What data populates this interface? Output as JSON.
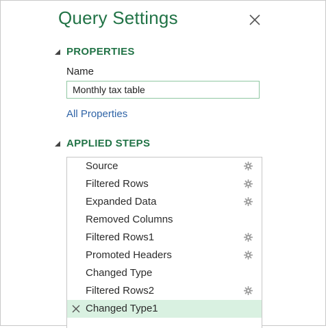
{
  "panel": {
    "title": "Query Settings",
    "close_icon": "close-icon"
  },
  "properties": {
    "header": "PROPERTIES",
    "name_label": "Name",
    "name_value": "Monthly tax table",
    "all_properties_link": "All Properties"
  },
  "applied_steps": {
    "header": "APPLIED STEPS",
    "selected_index": 8,
    "items": [
      {
        "label": "Source",
        "has_settings": true
      },
      {
        "label": "Filtered Rows",
        "has_settings": true
      },
      {
        "label": "Expanded Data",
        "has_settings": true
      },
      {
        "label": "Removed Columns",
        "has_settings": false
      },
      {
        "label": "Filtered Rows1",
        "has_settings": true
      },
      {
        "label": "Promoted Headers",
        "has_settings": true
      },
      {
        "label": "Changed Type",
        "has_settings": false
      },
      {
        "label": "Filtered Rows2",
        "has_settings": true
      },
      {
        "label": "Changed Type1",
        "has_settings": false
      }
    ]
  },
  "colors": {
    "accent": "#217346",
    "link": "#2e63a6",
    "selected_row": "#d9f1e1"
  }
}
